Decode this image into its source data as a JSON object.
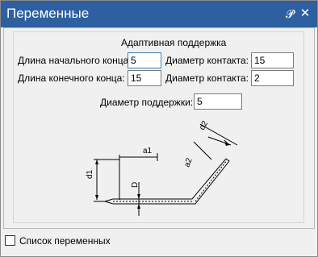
{
  "window": {
    "title": "Переменные",
    "pin_icon": "pin-icon",
    "close_icon": "close-icon"
  },
  "group": {
    "title": "Адаптивная поддержка"
  },
  "fields": {
    "start_length": {
      "label": "Длина начального конца:",
      "value": "5"
    },
    "end_length": {
      "label": "Длина конечного конца:",
      "value": "15"
    },
    "contact_diameter_1": {
      "label": "Диаметр контакта:",
      "value": "15"
    },
    "contact_diameter_2": {
      "label": "Диаметр контакта:",
      "value": "2"
    },
    "support_diameter": {
      "label": "Диаметр поддержки:",
      "value": "5"
    }
  },
  "diagram": {
    "labels": {
      "a1": "a1",
      "a2": "a2",
      "d1": "d1",
      "d2": "d2",
      "D": "D"
    }
  },
  "footer": {
    "variables_list_label": "Список переменных",
    "variables_list_checked": false
  },
  "colors": {
    "titlebar": "#2d5fa1",
    "focus_border": "#3c7fb1"
  }
}
